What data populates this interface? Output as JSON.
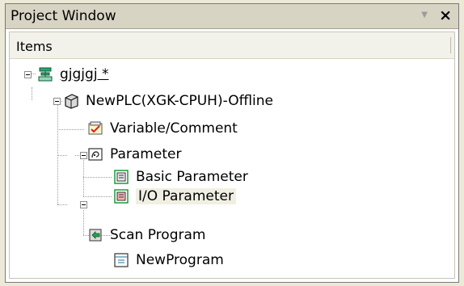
{
  "window": {
    "title": "Project Window"
  },
  "header": {
    "column": "Items"
  },
  "tree": {
    "project": "gjgjgj *",
    "plc": "NewPLC(XGK-CPUH)-Offline",
    "variable": "Variable/Comment",
    "parameter": "Parameter",
    "basic_param": "Basic Parameter",
    "io_param": "I/O Parameter",
    "scan": "Scan Program",
    "program": "NewProgram"
  },
  "icons": {
    "project": "project-icon",
    "plc": "plc-cpu-icon",
    "variable": "variable-comment-icon",
    "parameter": "parameter-folder-icon",
    "basic_param": "basic-parameter-icon",
    "io_param": "io-parameter-icon",
    "scan": "scan-program-icon",
    "program": "program-icon"
  }
}
